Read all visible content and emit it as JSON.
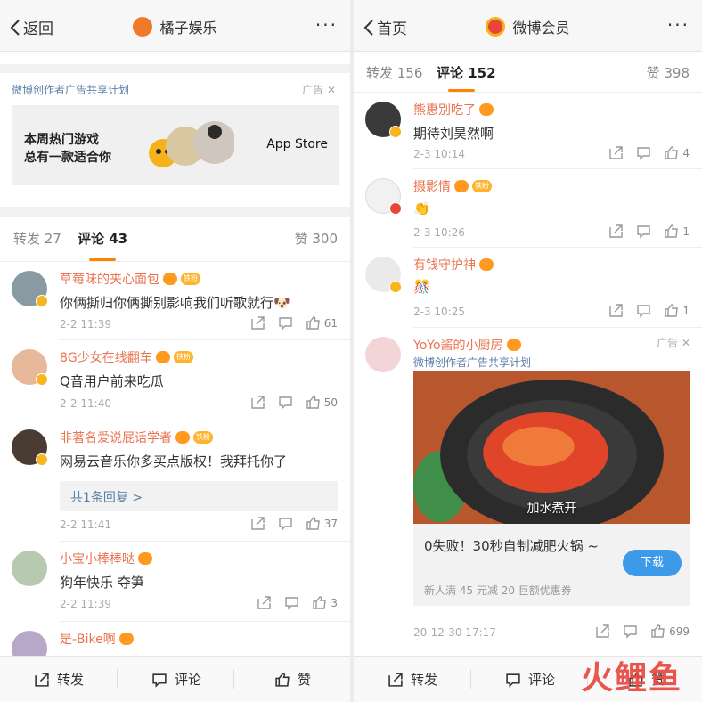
{
  "left": {
    "nav": {
      "back": "返回",
      "title": "橘子娱乐",
      "more": "···"
    },
    "ad": {
      "label": "微博创作者广告共享计划",
      "tag": "广告",
      "line1": "本周热门游戏",
      "line2": "总有一款适合你",
      "store": "App Store"
    },
    "tabs": {
      "repost": "转发 27",
      "comment": "评论 43",
      "like": "赞 300"
    },
    "comments": [
      {
        "name": "草莓味的夹心面包",
        "medal": "铁粉",
        "text": "你俩撕归你俩撕别影响我们听歌就行🐶",
        "time": "2-2 11:39",
        "likes": "61",
        "avatar_color": "#8a9aa3"
      },
      {
        "name": "8G少女在线翻车",
        "medal": "铁粉",
        "text": "Q音用户前来吃瓜",
        "time": "2-2 11:40",
        "likes": "50",
        "avatar_color": "#e8b89a"
      },
      {
        "name": "非著名爱说屁话学者",
        "medal": "铁粉",
        "text": "网易云音乐你多买点版权！我拜托你了",
        "time": "2-2 11:41",
        "likes": "37",
        "reply": "共1条回复 >",
        "avatar_color": "#4a3b33"
      },
      {
        "name": "小宝小棒棒哒",
        "medal": "",
        "text": "狗年快乐  夺笋",
        "time": "2-2 11:39",
        "likes": "3",
        "avatar_color": "#b7c9b0"
      },
      {
        "name": "是-Bike啊",
        "medal": "",
        "avatar_color": "#b7a8c9"
      }
    ],
    "bottom": {
      "repost": "转发",
      "comment": "评论",
      "like": "赞"
    }
  },
  "right": {
    "nav": {
      "back": "首页",
      "title": "微博会员",
      "more": "···"
    },
    "tabs": {
      "repost": "转发 156",
      "comment": "评论 152",
      "like": "赞 398"
    },
    "comments": [
      {
        "name": "熊惠别吃了",
        "text": "期待刘昊然啊",
        "time": "2-3 10:14",
        "likes": "4",
        "avatar_color": "#3a3a3a"
      },
      {
        "name": "摄影情",
        "medal": "铁粉",
        "text": "👏",
        "time": "2-3 10:26",
        "likes": "1",
        "avatar_color": "#f1f1f1"
      },
      {
        "name": "有钱守护神",
        "text": "🎊",
        "time": "2-3 10:25",
        "likes": "1",
        "avatar_color": "#eaeaea"
      }
    ],
    "ad_comment": {
      "name": "YoYo酱的小厨房",
      "tag": "广告",
      "sub": "微博创作者广告共享计划",
      "caption": "加水煮开",
      "headline": "0失败！30秒自制减肥火锅 ~",
      "promo": "新人满 45 元减 20 巨额优惠券",
      "button": "下载",
      "time": "20-12-30 17:17",
      "likes": "699",
      "avatar_color": "#f3d5d8"
    },
    "bottom": {
      "repost": "转发",
      "comment": "评论",
      "like": "赞"
    },
    "watermark": "火鲤鱼"
  }
}
